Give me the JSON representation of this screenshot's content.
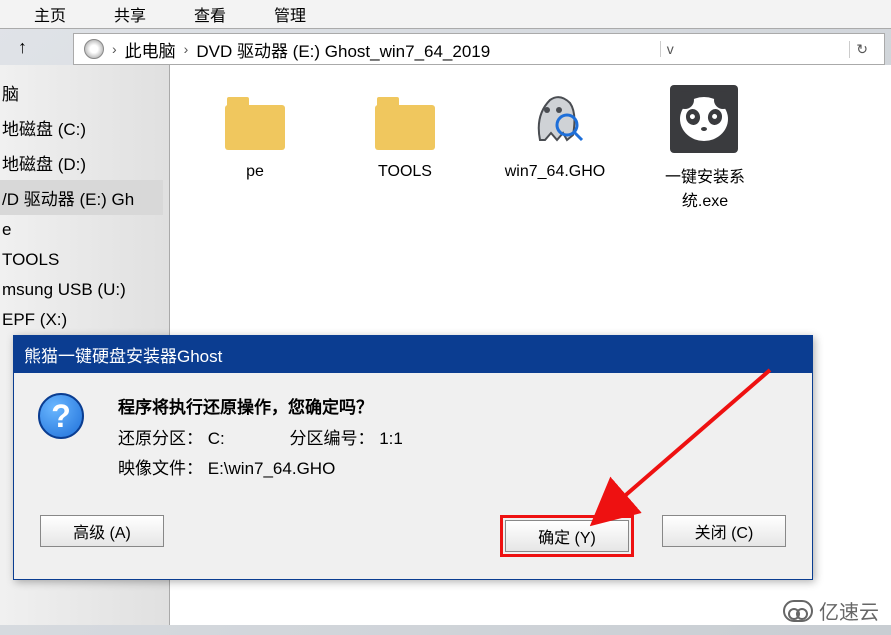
{
  "toolbar": {
    "home": "主页",
    "share": "共享",
    "view": "查看",
    "manage": "管理"
  },
  "breadcrumb": {
    "this_pc": "此电脑",
    "drive": "DVD 驱动器 (E:) Ghost_win7_64_2019"
  },
  "tree": {
    "this_pc": "脑",
    "cdrive": "地磁盘 (C:)",
    "ddrive": "地磁盘 (D:)",
    "dvd": "/D 驱动器 (E:) Gh",
    "pe": "e",
    "tools": "TOOLS",
    "usb": "msung USB (U:)",
    "epf": "EPF (X:)"
  },
  "items": {
    "pe": "pe",
    "tools": "TOOLS",
    "gho": "win7_64.GHO",
    "exe": "一键安装系统.exe"
  },
  "dialog": {
    "title": "熊猫一键硬盘安装器Ghost",
    "line1": "程序将执行还原操作，您确定吗？",
    "line2a": "还原分区：",
    "line2b": "C:",
    "line2c": "分区编号：",
    "line2d": "1:1",
    "line3a": "映像文件：",
    "line3b": "E:\\win7_64.GHO",
    "btn_adv": "高级 (A)",
    "btn_ok": "确定 (Y)",
    "btn_close": "关闭 (C)"
  },
  "watermark": "亿速云"
}
